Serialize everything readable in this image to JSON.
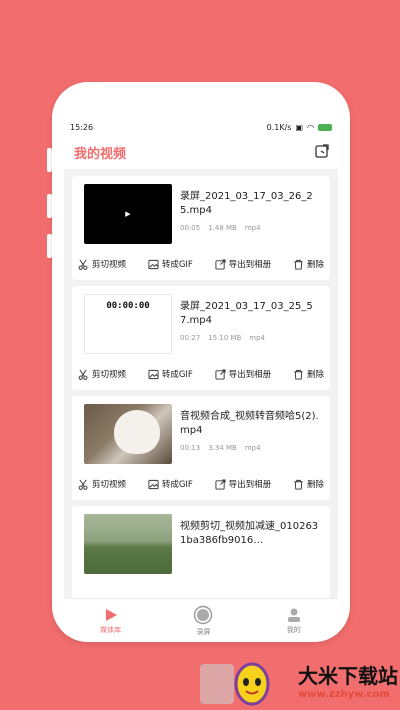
{
  "status_bar": {
    "time": "15:26",
    "speed": "0.1K/s",
    "battery": "100"
  },
  "header": {
    "title": "我的视频"
  },
  "videos": [
    {
      "name": "录屏_2021_03_17_03_26_25.mp4",
      "duration": "00:05",
      "size": "1.48 MB",
      "format": "mp4",
      "thumb_style": "black",
      "thumb_text": ""
    },
    {
      "name": "录屏_2021_03_17_03_25_57.mp4",
      "duration": "00:27",
      "size": "15.10 MB",
      "format": "mp4",
      "thumb_style": "white",
      "thumb_text": "00:00:00"
    },
    {
      "name": "音视频合成_视频转音频哈5(2).mp4",
      "duration": "00:13",
      "size": "3.34 MB",
      "format": "mp4",
      "thumb_style": "dog",
      "thumb_text": ""
    },
    {
      "name": "视频剪切_视频加减速_0102631ba386fb9016…",
      "duration": "",
      "size": "",
      "format": "",
      "thumb_style": "grass",
      "thumb_text": ""
    }
  ],
  "actions": {
    "cut": "剪切视频",
    "gif": "转成GIF",
    "export": "导出到相册",
    "delete": "删除"
  },
  "tabs": [
    {
      "label": "媒体库",
      "icon": "play-icon",
      "active": true
    },
    {
      "label": "录屏",
      "icon": "record-icon",
      "active": false
    },
    {
      "label": "我的",
      "icon": "user-icon",
      "active": false
    }
  ],
  "watermark": {
    "title": "大米下载站",
    "url": "www.zzhyw.com"
  },
  "colors": {
    "accent": "#f26d6d",
    "background": "#f26d6d"
  }
}
